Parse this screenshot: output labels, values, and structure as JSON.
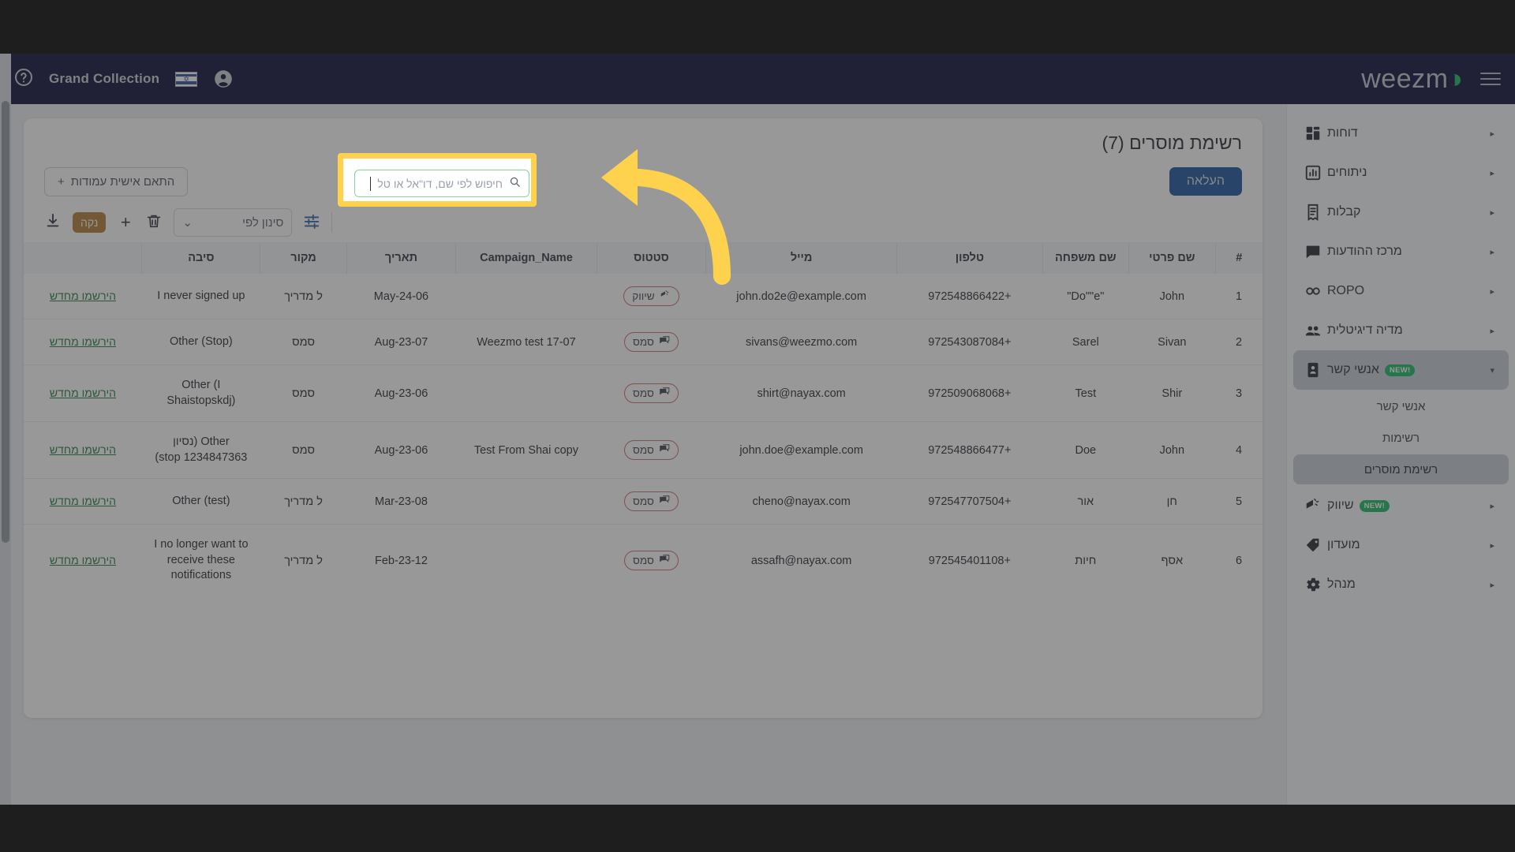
{
  "topbar": {
    "brand": "Grand Collection",
    "logo_text": "weezm",
    "logo_arc": "◑",
    "avatar_icon": "account-circle-icon",
    "flag_icon": "israel-flag-icon",
    "help_icon": "help-circle-icon",
    "menu_icon": "hamburger-menu-icon",
    "bg_color": "#050833"
  },
  "sidebar": {
    "items": [
      {
        "label": "דוחות",
        "icon": "dashboard-icon",
        "caret": "▸",
        "badge": ""
      },
      {
        "label": "ניתוחים",
        "icon": "bar-chart-icon",
        "caret": "▸",
        "badge": ""
      },
      {
        "label": "קבלות",
        "icon": "receipt-icon",
        "caret": "▸",
        "badge": ""
      },
      {
        "label": "מרכז ההודעות",
        "icon": "chat-bubble-icon",
        "caret": "▸",
        "badge": ""
      },
      {
        "label": "ROPO",
        "icon": "infinity-icon",
        "caret": "▸",
        "badge": ""
      },
      {
        "label": "מדיה דיגיטלית",
        "icon": "group-icon",
        "caret": "▸",
        "badge": ""
      },
      {
        "label": "אנשי קשר",
        "icon": "contact-card-icon",
        "caret": "▾",
        "badge": "NEW!"
      },
      {
        "label": "שיווק",
        "icon": "megaphone-icon",
        "caret": "▸",
        "badge": "NEW!"
      },
      {
        "label": "מועדון",
        "icon": "tag-icon",
        "caret": "▸",
        "badge": ""
      },
      {
        "label": "מנהל",
        "icon": "gear-icon",
        "caret": "▸",
        "badge": ""
      }
    ],
    "subitems": [
      {
        "label": "אנשי קשר",
        "active": false
      },
      {
        "label": "רשימות",
        "active": false
      },
      {
        "label": "רשימת מוסרים",
        "active": true
      }
    ],
    "active_index": 6,
    "active_color": "#c5ccd8",
    "badge_color": "#14b760"
  },
  "page": {
    "title": "רשימת מוסרים (7)",
    "upload_button": "העלאה",
    "customize_columns": "התאם אישית עמודות",
    "customize_columns_icon": "plus-icon",
    "upload_color": "#18509e"
  },
  "toolbar": {
    "download_icon": "download-icon",
    "clear_label": "נקה",
    "clear_color": "#b57730",
    "add_icon": "plus-icon",
    "delete_icon": "trash-icon",
    "filter_select_label": "סינון לפי",
    "filter_select_caret": "⌄",
    "settings_icon": "sliders-icon",
    "search_icon": "search-icon",
    "search_placeholder": "חיפוש לפי שם, דו\"אל או טל",
    "search_value": "",
    "search_border_color": "#83d6a4",
    "highlight_color": "#ffd24d"
  },
  "table": {
    "headers": {
      "num": "#",
      "first_name": "שם פרטי",
      "last_name": "שם משפחה",
      "phone": "טלפון",
      "email": "מייל",
      "status": "סטטוס",
      "campaign": "Campaign_Name",
      "date": "תאריך",
      "source": "מקור",
      "reason": "סיבה",
      "action": ""
    },
    "resubscribe_label": "הירשמו מחדש",
    "rows": [
      {
        "num": "1",
        "first_name": "John",
        "last_name": "\"Do\"\"e\"",
        "phone": "972548866422+",
        "email": "john.do2e@example.com",
        "status": "שיווק",
        "status_icon": "megaphone-icon",
        "campaign": "",
        "date": "May-24-06",
        "source": "ל מדריך",
        "reason": "I never signed up"
      },
      {
        "num": "2",
        "first_name": "Sivan",
        "last_name": "Sarel",
        "phone": "972543087084+",
        "email": "sivans@weezmo.com",
        "status": "סמס",
        "status_icon": "sms-icon",
        "campaign": "Weezmo test 17-07",
        "date": "Aug-23-07",
        "source": "סמס",
        "reason": "Other (Stop)"
      },
      {
        "num": "3",
        "first_name": "Shir",
        "last_name": "Test",
        "phone": "972509068068+",
        "email": "shirt@nayax.com",
        "status": "סמס",
        "status_icon": "sms-icon",
        "campaign": "",
        "date": "Aug-23-06",
        "source": "סמס",
        "reason": "Other (I Shaistopskdj)"
      },
      {
        "num": "4",
        "first_name": "John",
        "last_name": "Doe",
        "phone": "972548866477+",
        "email": "john.doe@example.com",
        "status": "סמס",
        "status_icon": "sms-icon",
        "campaign": "Test From Shai copy",
        "date": "Aug-23-06",
        "source": "סמס",
        "reason": "Other (נסיון 1234847363 stop)"
      },
      {
        "num": "5",
        "first_name": "חן",
        "last_name": "אור",
        "phone": "972547707504+",
        "email": "cheno@nayax.com",
        "status": "סמס",
        "status_icon": "sms-icon",
        "campaign": "",
        "date": "Mar-23-08",
        "source": "ל מדריך",
        "reason": "Other (test)"
      },
      {
        "num": "6",
        "first_name": "אסף",
        "last_name": "חיות",
        "phone": "972545401108+",
        "email": "assafh@nayax.com",
        "status": "סמס",
        "status_icon": "sms-icon",
        "campaign": "",
        "date": "Feb-23-12",
        "source": "ל מדריך",
        "reason": "I no longer want to receive these notifications"
      }
    ]
  },
  "overlay": {
    "dim_color": "rgba(58,58,58,.52)",
    "arrow_icon": "curved-arrow-pointing-left",
    "arrow_color": "#ffd24d"
  }
}
